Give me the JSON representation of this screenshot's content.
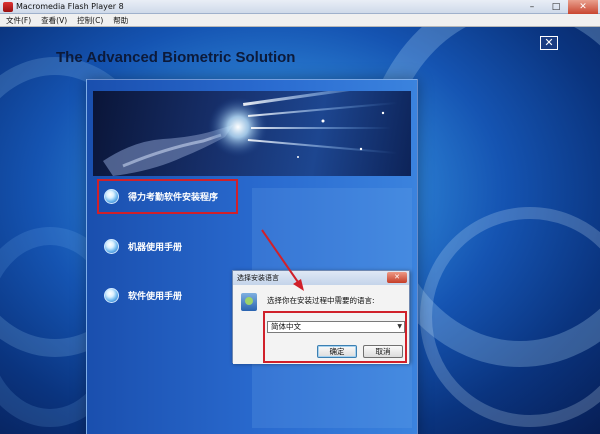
{
  "window": {
    "title": "Macromedia Flash Player 8",
    "controls": {
      "minimize": "–",
      "maximize": "□",
      "close": "✕"
    }
  },
  "menubar": [
    {
      "label": "文件(F)"
    },
    {
      "label": "查看(V)"
    },
    {
      "label": "控制(C)"
    },
    {
      "label": "帮助"
    }
  ],
  "stage": {
    "headline": "The Advanced Biometric Solution",
    "close_glyph": "✕",
    "options": [
      {
        "label": "得力考勤软件安装程序",
        "icon": "bullet-orb-icon"
      },
      {
        "label": "机器使用手册",
        "icon": "bullet-orb-icon"
      },
      {
        "label": "软件使用手册",
        "icon": "bullet-orb-icon"
      }
    ]
  },
  "dialog": {
    "title": "选择安装语言",
    "close_glyph": "✕",
    "prompt": "选择你在安装过程中需要的语言:",
    "language_selected": "简体中文",
    "ok_label": "确定",
    "cancel_label": "取消"
  },
  "colors": {
    "annotation_red": "#d0202a",
    "stage_blue": "#1554b2",
    "headline": "#0c1a3a"
  }
}
